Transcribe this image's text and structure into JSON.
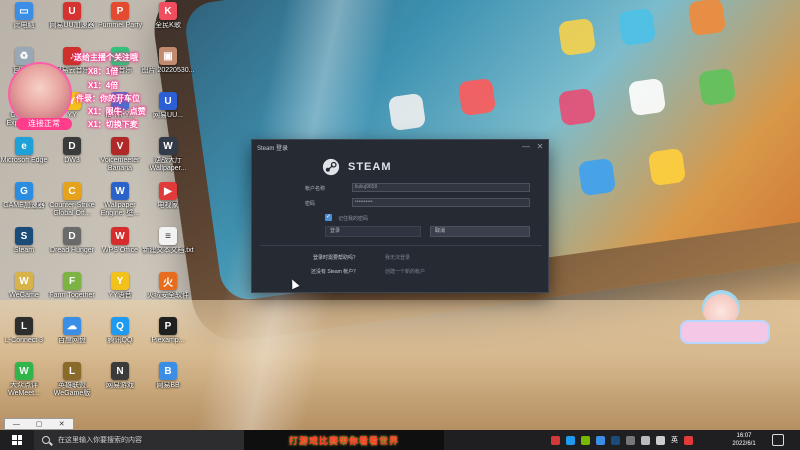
{
  "desktop": {
    "icons": [
      {
        "label": "此电脑",
        "color": "#3a8ee6",
        "glyph": "▭"
      },
      {
        "label": "网易UU加速器",
        "color": "#d6322f",
        "glyph": "U"
      },
      {
        "label": "Pummel Party",
        "color": "#e44a2f",
        "glyph": "P"
      },
      {
        "label": "全民K歌",
        "color": "#f04e5e",
        "glyph": "K"
      },
      {
        "label": "回收站",
        "color": "#9aa8b5",
        "glyph": "♻"
      },
      {
        "label": "网易云音乐",
        "color": "#d0302c",
        "glyph": "♪"
      },
      {
        "label": "QQ音乐",
        "color": "#31c27c",
        "glyph": "♫"
      },
      {
        "label": "图片 20220530...",
        "color": "#c08b6e",
        "glyph": "▣"
      },
      {
        "label": "GeForce Experience",
        "color": "#76b900",
        "glyph": "G"
      },
      {
        "label": "YY",
        "color": "#f3c11b",
        "glyph": "Y"
      },
      {
        "label": "Ib YR Y...",
        "color": "#4a6fd0",
        "glyph": "I"
      },
      {
        "label": "网易UU...",
        "color": "#2c5fd5",
        "glyph": "U"
      },
      {
        "label": "Microsoft Edge",
        "color": "#1ea1d6",
        "glyph": "e"
      },
      {
        "label": "DW3",
        "color": "#3b3b3b",
        "glyph": "D"
      },
      {
        "label": "Voicemeeter Banana",
        "color": "#b02828",
        "glyph": "V"
      },
      {
        "label": "逆战大厅 Wallpaper...",
        "color": "#333a4a",
        "glyph": "W"
      },
      {
        "label": "GAME加速器",
        "color": "#2a8de0",
        "glyph": "G"
      },
      {
        "label": "Counter-Strike Global Off...",
        "color": "#e5a21a",
        "glyph": "C"
      },
      {
        "label": "Wallpaper Engine: 壁...",
        "color": "#2a62c9",
        "glyph": "W"
      },
      {
        "label": "电视家",
        "color": "#e13a3a",
        "glyph": "▶"
      },
      {
        "label": "Steam",
        "color": "#1b4b78",
        "glyph": "S"
      },
      {
        "label": "Dread Hunger",
        "color": "#6a6a6a",
        "glyph": "D"
      },
      {
        "label": "WPS Office",
        "color": "#d62c2c",
        "glyph": "W"
      },
      {
        "label": "新建文本文档.txt",
        "color": "#f2f2f2",
        "glyph": "≡"
      },
      {
        "label": "WeGame",
        "color": "#d7b34a",
        "glyph": "W"
      },
      {
        "label": "Farm Together",
        "color": "#7bb443",
        "glyph": "F"
      },
      {
        "label": "YY语音",
        "color": "#f3c11b",
        "glyph": "Y"
      },
      {
        "label": "火绒安全软件",
        "color": "#e86c1e",
        "glyph": "火"
      },
      {
        "label": "L-Connect 3",
        "color": "#2d2d2d",
        "glyph": "L"
      },
      {
        "label": "百度网盘",
        "color": "#3a8ee6",
        "glyph": "☁"
      },
      {
        "label": "腾讯QQ",
        "color": "#1e9bf0",
        "glyph": "Q"
      },
      {
        "label": "Plexamp...",
        "color": "#202020",
        "glyph": "P"
      },
      {
        "label": "大众点评 WeMeet...",
        "color": "#2fb54a",
        "glyph": "W"
      },
      {
        "label": "英雄联盟 WeGame版",
        "color": "#8a6a2a",
        "glyph": "L"
      },
      {
        "label": "网易游戏",
        "color": "#3b3b3b",
        "glyph": "N"
      },
      {
        "label": "网易BB",
        "color": "#3a8ee6",
        "glyph": "B"
      }
    ]
  },
  "overlay": {
    "badge": "连接正常",
    "lines": [
      "送给主播个关注哦",
      "X8：1倍",
      "X1：4倍",
      "件录：你的开车位",
      "X1：限牛：点赞",
      "X1：切换下麦"
    ]
  },
  "steam": {
    "window_title": "Steam 登录",
    "close_glyph": "✕",
    "min_glyph": "—",
    "wordmark": "STEAM",
    "username_label": "帐户名称",
    "username_value": "liuliuj9658",
    "password_label": "密码",
    "password_value": "••••••••••",
    "remember_label": "记住我的密码",
    "login_button": "登录",
    "cancel_button": "取消",
    "help_question": "登录时需要帮助吗？",
    "help_answer": "我无法登录",
    "account_question": "还没有 Steam 帐户？",
    "account_answer": "创建一个新的帐户"
  },
  "taskbar": {
    "search_placeholder": "在这里输入你要搜索的内容",
    "banner": "打游戏比赛带你看看世界",
    "time": "16:07",
    "date": "2022/6/1",
    "ime": "英",
    "mini_window_buttons": [
      "—",
      "▢",
      "✕"
    ]
  }
}
